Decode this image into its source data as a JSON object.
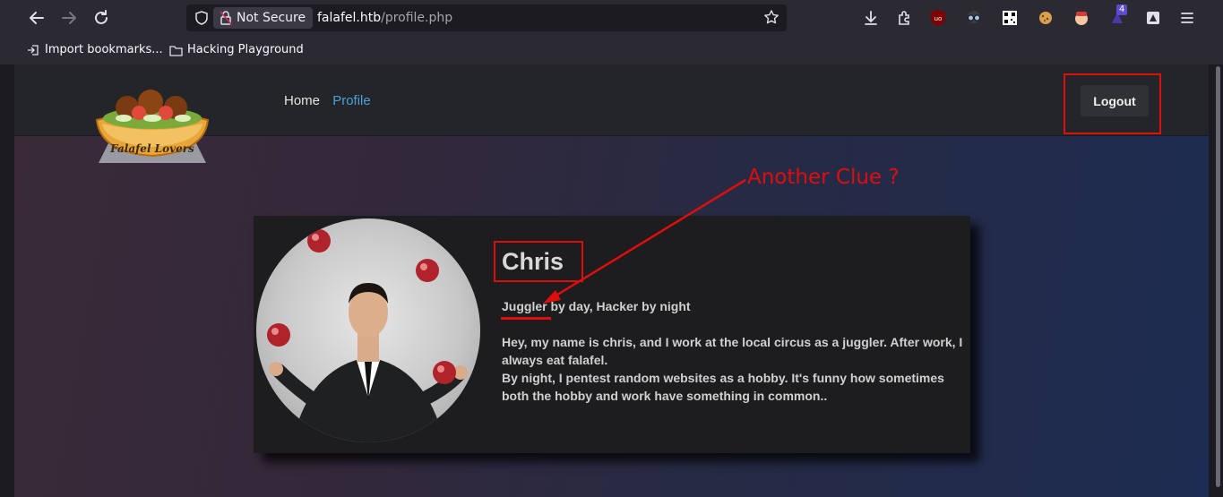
{
  "browser": {
    "security_label": "Not Secure",
    "url_domain": "falafel.htb",
    "url_path": "/profile.php",
    "extension_badge": "4",
    "bookmarks": [
      {
        "label": "Import bookmarks..."
      },
      {
        "label": "Hacking Playground"
      }
    ]
  },
  "site": {
    "logo_text": "Falafel Lovers",
    "nav": {
      "home": "Home",
      "profile": "Profile"
    },
    "logout_label": "Logout"
  },
  "profile": {
    "name": "Chris",
    "tagline": "Juggler by day, Hacker by night",
    "bio_line1": "Hey, my name is chris, and I work at the local circus as a juggler. After work, I always eat falafel.",
    "bio_line2": "By night, I pentest random websites as a hobby. It's funny how sometimes both the hobby and work have something in common.."
  },
  "annotation": {
    "text": "Another Clue ?",
    "color": "#e00d0d"
  }
}
